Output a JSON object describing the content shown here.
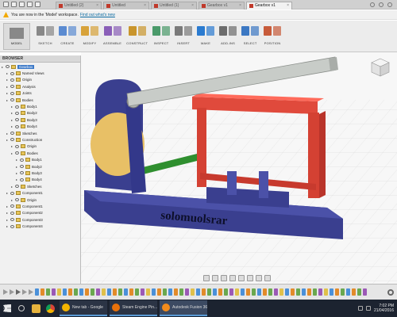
{
  "tabs": [
    {
      "label": "Untitled (2)",
      "active": false
    },
    {
      "label": "Untitled",
      "active": false
    },
    {
      "label": "Untitled (1)",
      "active": false
    },
    {
      "label": "Gearbox v1",
      "active": false
    },
    {
      "label": "Gearbox v1",
      "active": true
    }
  ],
  "warning": {
    "text": "You are now in the 'Model' workspace.",
    "link": "Find out what's new"
  },
  "ribbon": {
    "workspace": "MODEL",
    "groups": [
      "SKETCH",
      "CREATE",
      "MODIFY",
      "ASSEMBLE",
      "CONSTRUCT",
      "INSPECT",
      "INSERT",
      "MAKE",
      "ADD-INS",
      "SELECT",
      "POSITION"
    ]
  },
  "browser": {
    "title": "BROWSER",
    "items": [
      {
        "label": "Gearbox",
        "selected": true,
        "depth": 0
      },
      {
        "label": "Named Views",
        "depth": 1
      },
      {
        "label": "Origin",
        "depth": 1
      },
      {
        "label": "Analysis",
        "depth": 1
      },
      {
        "label": "Joints",
        "depth": 1
      },
      {
        "label": "Bodies",
        "depth": 1
      },
      {
        "label": "Body1",
        "depth": 2
      },
      {
        "label": "Body2",
        "depth": 2
      },
      {
        "label": "Body3",
        "depth": 2
      },
      {
        "label": "Body4",
        "depth": 2
      },
      {
        "label": "Sketches",
        "depth": 1
      },
      {
        "label": "Construction",
        "depth": 1
      },
      {
        "label": "Origin",
        "depth": 2
      },
      {
        "label": "Bodies",
        "depth": 2
      },
      {
        "label": "Body1",
        "depth": 3
      },
      {
        "label": "Body2",
        "depth": 3
      },
      {
        "label": "Body3",
        "depth": 3
      },
      {
        "label": "Body4",
        "depth": 3
      },
      {
        "label": "Sketches",
        "depth": 2
      },
      {
        "label": "Component1",
        "depth": 1
      },
      {
        "label": "Origin",
        "depth": 2
      },
      {
        "label": "Component1",
        "depth": 1
      },
      {
        "label": "Component2",
        "depth": 1
      },
      {
        "label": "Component3",
        "depth": 1
      },
      {
        "label": "Component4",
        "depth": 1
      }
    ]
  },
  "model": {
    "base_text": "solomuolsrar"
  },
  "taskbar": {
    "apps": [
      {
        "label": "New tab - Google",
        "color": "#f4b400"
      },
      {
        "label": "Steam Engine Pin...",
        "color": "#e8710a"
      },
      {
        "label": "Autodesk Fusion 360",
        "color": "#f28b1c"
      }
    ],
    "time": "7:02 PM",
    "date": "21/04/2016"
  },
  "colors": {
    "frame_red": "#e04a3c",
    "base_blue": "#3a3f8f",
    "arm_grey": "#c8ccc8",
    "disc_gold": "#e8c066",
    "rod_green": "#2f8f2f"
  }
}
